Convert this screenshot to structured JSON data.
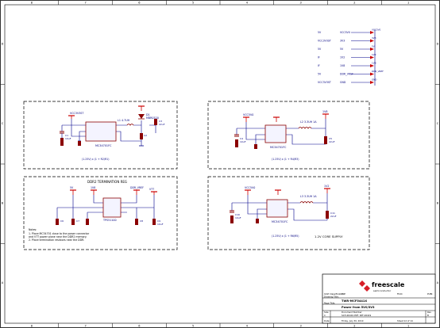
{
  "border": {
    "cols": [
      "8",
      "7",
      "6",
      "5",
      "4",
      "3",
      "2",
      "1"
    ],
    "rows": [
      "D",
      "C",
      "B",
      "A"
    ]
  },
  "power_table": [
    {
      "left": "5V",
      "mid": "VCC5V0",
      "tag": "VCC5V0"
    },
    {
      "left": "VCC3V3ST",
      "mid": "3V3",
      "tag": "3V3"
    },
    {
      "left": "5V",
      "mid": "5V",
      "tag": "5V"
    },
    {
      "left": "IF",
      "mid": "1V2",
      "tag": "1V2"
    },
    {
      "left": "IF",
      "mid": "1V8",
      "tag": "1V8"
    },
    {
      "left": "5V",
      "mid": "DDR_VREF",
      "tag": "DDR_VREF"
    },
    {
      "left": "VCC3V3ST",
      "mid": "GND",
      "tag": "GND"
    }
  ],
  "blocks": {
    "b1": {
      "rail": "VCC3V3ST",
      "ic": "MC34701FC",
      "inductor": "L1 4.7UH",
      "diode": "D1",
      "diode_part": "MBR0520",
      "caps": [
        "C1",
        "10uF",
        "C2",
        "C3",
        "22uF"
      ],
      "output": "VCC3V3ST",
      "formula": "(1.25V) x (1 + R2/R1)"
    },
    "b2": {
      "rail": "VCC5V0",
      "ic": "MC34701FC",
      "inductor": "L2 3.3UH 1A",
      "output": "1V8",
      "caps": [
        "C4",
        "10uF",
        "C5",
        "22uF"
      ],
      "formula": "(1.25V) x (1 + R4/R3)"
    },
    "b3": {
      "title": "DDR2 TERMINATION REG",
      "ic": "TPS51100",
      "rails": [
        "5V",
        "1V8",
        "DDR_VREF",
        "VTT"
      ],
      "caps": [
        "C6",
        "C7",
        "C8",
        "C9",
        "10uF"
      ],
      "notes": [
        "Notes:",
        "1. Place MC34701 close to the power connector",
        "   and VTT power plane near the DDR2 memory.",
        "2. Place termination resistors near the DDR."
      ]
    },
    "b4": {
      "rail": "VCC5V0",
      "ic": "MC34701FC",
      "inductor": "L3 3.3UH 1A",
      "output": "1V2",
      "caps": [
        "C10",
        "10uF",
        "C11",
        "22uF"
      ],
      "formula": "(1.25V) x (1 + R6/R5)",
      "title": "1.2V CORE SUPPLY"
    }
  },
  "title_block": {
    "logo": "freescale",
    "logo_sub": "semiconductor",
    "rows": [
      {
        "a": "ICAP Classification:",
        "b": "FCP",
        "c": "FIUO:",
        "d": "PUBI:"
      },
      {
        "a": "Drawing Title:",
        "b": "",
        "c": "",
        "d": ""
      },
      {
        "a": "",
        "b": "TWR-MCF5441X",
        "c": "",
        "d": ""
      },
      {
        "a": "Page Title:",
        "b": "",
        "c": "",
        "d": ""
      },
      {
        "a": "",
        "b": "Power from 5V0/3V3",
        "c": "",
        "d": ""
      },
      {
        "a": "Size",
        "b": "Document Number",
        "c": "",
        "d": "Rev"
      },
      {
        "a": "C",
        "b": "SCH-26419 PDF: SPF-26419",
        "c": "",
        "d": "B"
      },
      {
        "a": "Date:",
        "b": "Friday, July 30, 2010",
        "c": "Sheet 12 of 14",
        "d": ""
      }
    ]
  },
  "colors": {
    "wire": "#00008b",
    "part": "#8b0000",
    "power": "#cc0000",
    "text": "#000080",
    "border": "#000000"
  }
}
